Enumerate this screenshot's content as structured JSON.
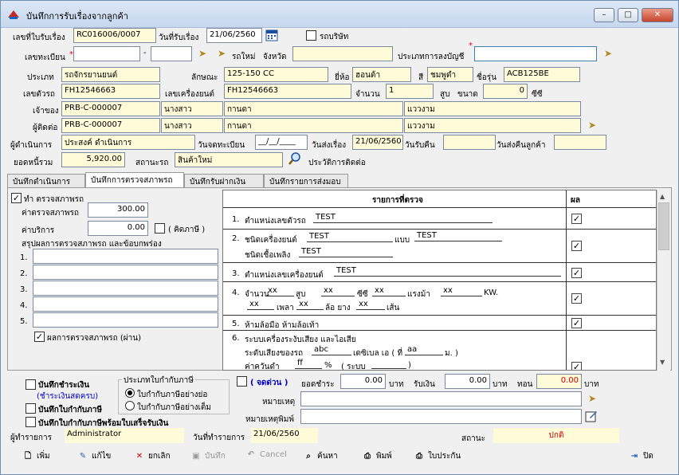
{
  "window": {
    "title": "บันทึกการรับเรื่องจากลูกค้า",
    "min": "–",
    "max": "□",
    "close": "✕"
  },
  "header": {
    "doc_no_label": "เลขที่ใบรับเรื่อง",
    "doc_no": "RC016006/0007",
    "date_label": "วันที่รับเรื่อง",
    "date": "21/06/2560",
    "company_car_label": "รถบริษัท",
    "reg_label": "เลขทะเบียน",
    "new_car_label": "รถใหม่",
    "province_label": "จังหวัด",
    "account_type_label": "ประเภทการลงบัญชี"
  },
  "vehicle": {
    "type_label": "ประเภท",
    "type": "รถจักรยานยนต์",
    "feature_label": "ลักษณะ",
    "feature": "125-150 CC",
    "brand_label": "ยี่ห้อ",
    "brand": "ฮอนด้า",
    "color_label": "สี",
    "color": "ชมพูดำ",
    "model_label": "ชื่อรุ่น",
    "model": "ACB125BE",
    "chassis_label": "เลขตัวรถ",
    "chassis": "FH12546663",
    "engine_label": "เลขเครื่องยนต์",
    "engine": "FH12546663",
    "qty_label": "จำนวน",
    "qty": "1",
    "cyl_label": "สูบ",
    "size_label": "ขนาด",
    "size": "0",
    "cc_label": "ซีซี"
  },
  "owner": {
    "label": "เจ้าของ",
    "code": "PRB-C-000007",
    "title": "นางสาว",
    "first": "กานดา",
    "last": "แววงาม"
  },
  "contact": {
    "label": "ผู้ติดต่อ",
    "code": "PRB-C-000007",
    "title": "นางสาว",
    "first": "กานดา",
    "last": "แววงาม"
  },
  "process": {
    "label": "ผู้ดำเนินการ",
    "value": "ประสงค์ ดำเนินการ",
    "reg_date_label": "วันจดทะเบียน",
    "reg_date": "__/__/____",
    "send_date_label": "วันส่งเรื่อง",
    "send_date": "21/06/2560",
    "receive_label": "วันรับคืน",
    "return_label": "วันส่งคืนลูกค้า"
  },
  "totals": {
    "label": "ยอดหนี้รวม",
    "value": "5,920.00",
    "status_label": "สถานะรถ",
    "status": "สินค้าใหม่",
    "history_label": "ประวัติการติดต่อ"
  },
  "tabs": [
    "บันทึกดำเนินการ",
    "บันทึกการตรวจสภาพรถ",
    "บันทึกรับฝากเงิน",
    "บันทึกรายการส่งมอบ"
  ],
  "inspect": {
    "check_label": "ทำ ตรวจสภาพรถ",
    "fee_label": "ค่าตรวจสภาพรถ",
    "fee": "300.00",
    "service_label": "ค่าบริการ",
    "service": "0.00",
    "vat_label": "( คิดภาษี )",
    "summary_label": "สรุปผลการตรวจสภาพรถ และข้อบกพร่อง",
    "lines": [
      "1.",
      "2.",
      "3.",
      "4.",
      "5."
    ],
    "pass_label": "ผลการตรวจสภาพรถ (ผ่าน)"
  },
  "table": {
    "head": "รายการที่ตรวจ",
    "result_head": "ผล",
    "r1": {
      "no": "1.",
      "label": "ตำแหน่งเลขตัวรถ",
      "val": "TEST"
    },
    "r2": {
      "no": "2.",
      "label": "ชนิดเครื่องยนต์",
      "val": "TEST",
      "type_label": "แบบ",
      "type_val": "TEST",
      "fuel_label": "ชนิดเชื้อเพลิง",
      "fuel_val": "TEST"
    },
    "r3": {
      "no": "3.",
      "label": "ตำแหน่งเลขเครื่องยนต์",
      "val": "TEST"
    },
    "r4": {
      "no": "4.",
      "qty_label": "จำนวน",
      "qty": "xx",
      "cyl_label": "สูบ",
      "cyl": "xx",
      "cc_label": "ซีซี",
      "cc": "xx",
      "hp_label": "แรงม้า",
      "hp": "xx",
      "kw_label": "KW.",
      "axle": "xx",
      "axle_label": "เพลา",
      "wheel": "xx",
      "wheel_label": "ล้อ ยาง",
      "tire": "xx",
      "tire_label": "เส้น"
    },
    "r5": {
      "no": "5.",
      "label": "ห้ามล้อมือ ห้ามล้อเท้า"
    },
    "r6": {
      "no": "6.",
      "label": "ระบบเครื่องระงับเสียง และไอเสีย",
      "noise_label": "ระดับเสียงของรถ",
      "noise": "abc",
      "db_label": "เดซิเบล เอ ( ที่",
      "aa": "aa",
      "m_label": "ม. )",
      "smoke_label": "ค่าควันดำ",
      "smoke": "ff",
      "pct_label": "%",
      "sys_label": "( ระบบ",
      "sys_close": ")"
    }
  },
  "payment": {
    "pay_label": "บันทึกชำระเงิน",
    "pay_sub": "(ชำระเงินสดครบ)",
    "tax_label": "บันทึกใบกำกับภาษี",
    "tax_receipt_label": "บันทึกใบกำกับภาษีพร้อมใบเสร็จรับเงิน",
    "tax_type_label": "ประเภทใบกำกับภาษี",
    "short_label": "ใบกำกับภาษีอย่างย่อ",
    "full_label": "ใบกำกับภาษีอย่างเต็ม",
    "urgent_label": "( จดด่วน )",
    "amount_label": "ยอดชำระ",
    "amount": "0.00",
    "baht1": "บาท",
    "received_label": "รับเงิน",
    "received": "0.00",
    "baht2": "บาท",
    "change_label": "ทอน",
    "change": "0.00",
    "baht3": "บาท",
    "note_label": "หมายเหตุ",
    "note_print_label": "หมายเหตุพิมพ์"
  },
  "footer": {
    "user_label": "ผู้ทำรายการ",
    "user": "Administrator",
    "date_label": "วันที่ทำรายการ",
    "date": "21/06/2560",
    "status_label": "สถานะ",
    "status": "ปกติ"
  },
  "buttons": {
    "add": "เพิ่ม",
    "edit": "แก้ไข",
    "cancel_doc": "ยกเลิก",
    "save": "บันทึก",
    "cancel": "Cancel",
    "search": "ค้นหา",
    "print": "พิมพ์",
    "invoice": "ใบประกัน",
    "close": "ปิด"
  },
  "colors": {
    "required": "#e0001b",
    "urgent": "#0000cc",
    "status": "#d10000"
  }
}
